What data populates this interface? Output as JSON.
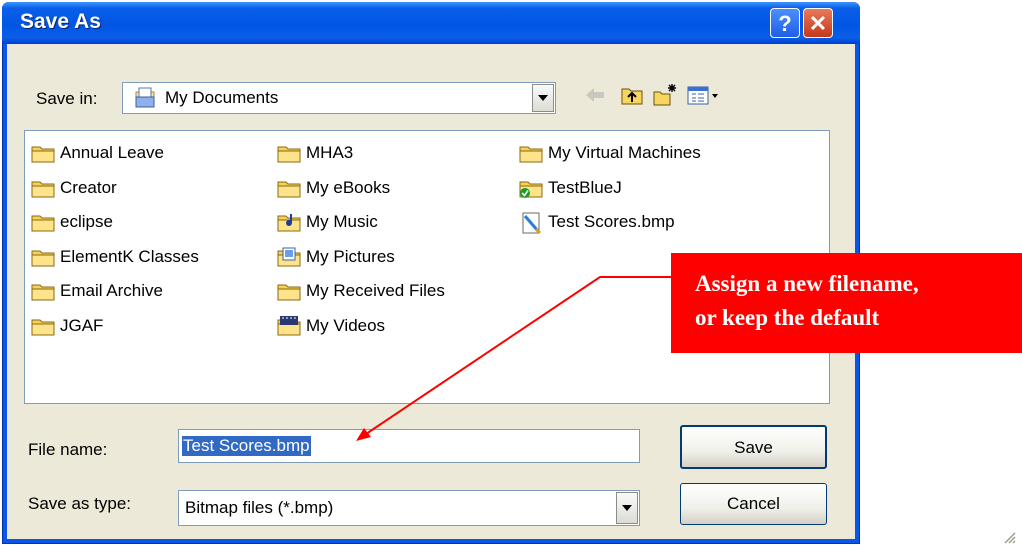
{
  "dialog": {
    "title": "Save As",
    "help_label": "?",
    "close_label": "✕"
  },
  "toolbar": {
    "save_in_label": "Save in:",
    "save_in_value": "My Documents",
    "icons": [
      "back-arrow-icon",
      "up-one-level-icon",
      "new-folder-icon",
      "views-menu-icon"
    ]
  },
  "files": {
    "col1": [
      "Annual Leave",
      "Creator",
      "eclipse",
      "ElementK Classes",
      "Email Archive",
      "JGAF"
    ],
    "col2": [
      "MHA3",
      "My eBooks",
      "My Music",
      "My Pictures",
      "My Received Files",
      "My Videos"
    ],
    "col3": [
      "My Virtual Machines",
      "TestBlueJ",
      "Test Scores.bmp"
    ]
  },
  "form": {
    "filename_label": "File name:",
    "filename_value": "Test Scores.bmp",
    "type_label": "Save as type:",
    "type_value": "Bitmap files (*.bmp)"
  },
  "buttons": {
    "save": "Save",
    "cancel": "Cancel"
  },
  "callout": {
    "line1": "Assign a new filename,",
    "line2": "or keep the default"
  },
  "colors": {
    "titlebar": "#0A55EA",
    "dialog_bg": "#ECE9D8",
    "selection": "#316AC5",
    "callout": "#FF0000"
  }
}
